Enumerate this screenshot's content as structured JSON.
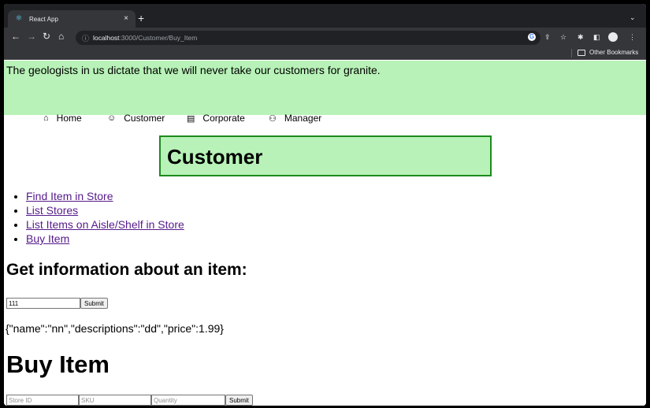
{
  "browser": {
    "tab_title": "React App",
    "tab_close": "×",
    "new_tab": "+",
    "tab_search": "⌄",
    "url_host": "localhost",
    "url_path": ":3000/Customer/Buy_Item",
    "bookmark_folder": "Other Bookmarks",
    "icons": [
      "react-icon",
      "back-icon",
      "forward-icon",
      "reload-icon",
      "home-icon",
      "info-icon",
      "google-icon",
      "share-icon",
      "star-icon",
      "extensions-icon",
      "sidebar-icon",
      "profile-icon",
      "menu-icon"
    ]
  },
  "page": {
    "tagline": "The geologists in us dictate that we will never take our customers for granite.",
    "nav": [
      {
        "label": "Home",
        "icon": "home-icon"
      },
      {
        "label": "Customer",
        "icon": "smiley-icon"
      },
      {
        "label": "Corporate",
        "icon": "building-icon"
      },
      {
        "label": "Manager",
        "icon": "manager-icon"
      }
    ],
    "customer_title": "Customer",
    "links": [
      "Find Item in Store",
      "List Stores",
      "List Items on Aisle/Shelf in Store",
      "Buy Item"
    ],
    "info_heading": "Get information about an item:",
    "info_form": {
      "value": "111",
      "submit": "Submit"
    },
    "result": "{\"name\":\"nn\",\"descriptions\":\"dd\",\"price\":1.99}",
    "buy_heading": "Buy Item",
    "buy_form": {
      "store_placeholder": "Store ID",
      "sku_placeholder": "SKU",
      "quantity_placeholder": "Quantity",
      "submit": "Submit"
    }
  },
  "colors": {
    "banner": "#b8f2b8",
    "box_border": "#1d8a1d",
    "link": "#551a8b"
  }
}
